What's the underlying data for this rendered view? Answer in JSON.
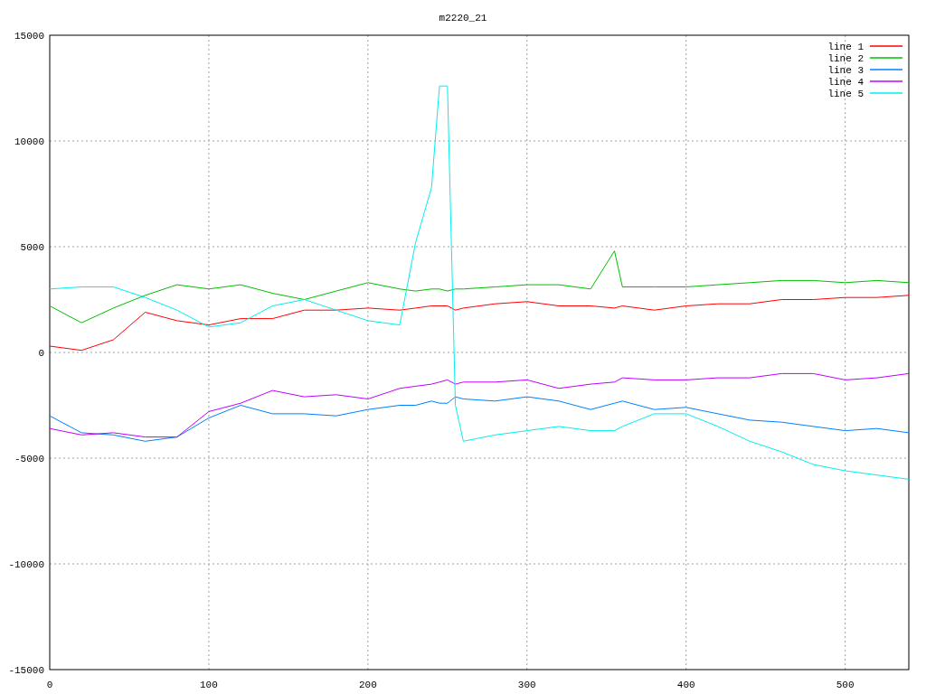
{
  "chart_data": {
    "type": "line",
    "title": "m2220_21",
    "x": [
      0,
      20,
      40,
      60,
      80,
      100,
      120,
      140,
      160,
      180,
      200,
      220,
      230,
      240,
      245,
      250,
      255,
      260,
      280,
      300,
      320,
      340,
      355,
      360,
      380,
      400,
      420,
      440,
      460,
      480,
      500,
      520,
      540
    ],
    "xlim": [
      0,
      540
    ],
    "ylim": [
      -15000,
      15000
    ],
    "xticks": [
      0,
      100,
      200,
      300,
      400,
      500
    ],
    "yticks": [
      -15000,
      -10000,
      -5000,
      0,
      5000,
      10000,
      15000
    ],
    "grid": true,
    "legend": true,
    "series": [
      {
        "name": "line 1",
        "color": "#ff0000",
        "values": [
          300,
          100,
          600,
          1900,
          1500,
          1300,
          1600,
          1600,
          2000,
          2000,
          2100,
          2000,
          2100,
          2200,
          2200,
          2200,
          2000,
          2100,
          2300,
          2400,
          2200,
          2200,
          2100,
          2200,
          2000,
          2200,
          2300,
          2300,
          2500,
          2500,
          2600,
          2600,
          2700
        ]
      },
      {
        "name": "line 2",
        "color": "#00c000",
        "values": [
          2200,
          1400,
          2100,
          2700,
          3200,
          3000,
          3200,
          2800,
          2500,
          2900,
          3300,
          3000,
          2900,
          3000,
          3000,
          2900,
          3000,
          3000,
          3100,
          3200,
          3200,
          3000,
          4800,
          3100,
          3100,
          3100,
          3200,
          3300,
          3400,
          3400,
          3300,
          3400,
          3300
        ]
      },
      {
        "name": "line 3",
        "color": "#0080ff",
        "values": [
          -3000,
          -3800,
          -3900,
          -4200,
          -4000,
          -3100,
          -2500,
          -2900,
          -2900,
          -3000,
          -2700,
          -2500,
          -2500,
          -2300,
          -2400,
          -2400,
          -2100,
          -2200,
          -2300,
          -2100,
          -2300,
          -2700,
          -2400,
          -2300,
          -2700,
          -2600,
          -2900,
          -3200,
          -3300,
          -3500,
          -3700,
          -3600,
          -3800
        ]
      },
      {
        "name": "line 4",
        "color": "#c000ff",
        "values": [
          -3600,
          -3900,
          -3800,
          -4000,
          -4000,
          -2800,
          -2400,
          -1800,
          -2100,
          -2000,
          -2200,
          -1700,
          -1600,
          -1500,
          -1400,
          -1300,
          -1500,
          -1400,
          -1400,
          -1300,
          -1700,
          -1500,
          -1400,
          -1200,
          -1300,
          -1300,
          -1200,
          -1200,
          -1000,
          -1000,
          -1300,
          -1200,
          -1000
        ]
      },
      {
        "name": "line 5",
        "color": "#00eeee",
        "values": [
          3000,
          3100,
          3100,
          2600,
          2000,
          1200,
          1400,
          2200,
          2500,
          2000,
          1500,
          1300,
          5200,
          7800,
          12600,
          12600,
          -2500,
          -4200,
          -3900,
          -3700,
          -3500,
          -3700,
          -3700,
          -3500,
          -2900,
          -2900,
          -3500,
          -4200,
          -4700,
          -5300,
          -5600,
          -5800,
          -6000
        ]
      }
    ]
  }
}
